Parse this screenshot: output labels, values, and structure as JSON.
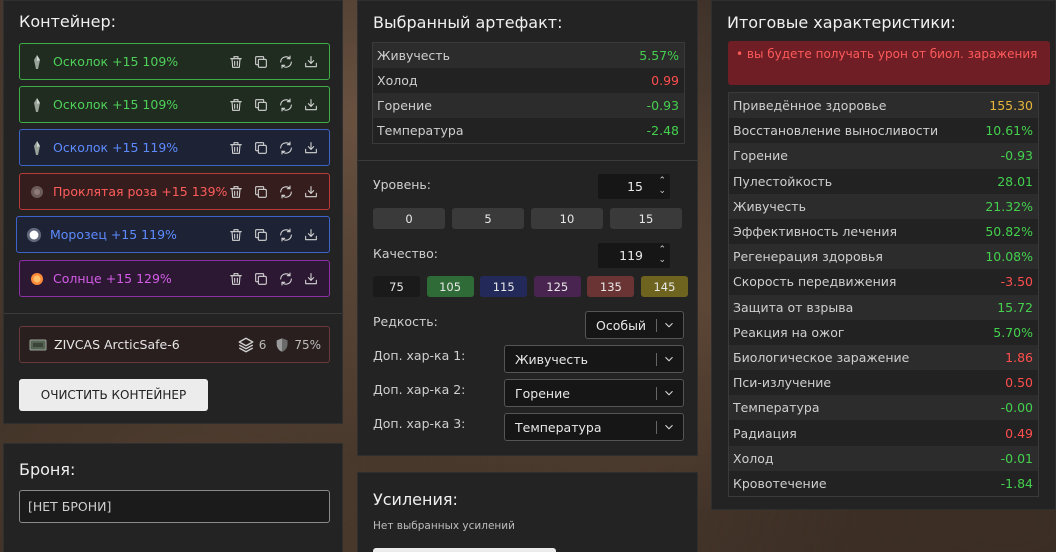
{
  "container": {
    "title": "Контейнер:",
    "artifacts": [
      {
        "name": "Осколок +15 109%",
        "color": "green",
        "icon": "shard-icon"
      },
      {
        "name": "Осколок +15 109%",
        "color": "green",
        "icon": "shard-icon"
      },
      {
        "name": "Осколок +15 119%",
        "color": "blue",
        "icon": "shard-icon"
      },
      {
        "name": "Проклятая роза +15 139%",
        "color": "red",
        "icon": "rose-icon"
      },
      {
        "name": "Морозец +15 119%",
        "color": "blue",
        "icon": "frost-icon"
      },
      {
        "name": "Солнце +15 129%",
        "color": "purple",
        "icon": "sun-icon"
      }
    ],
    "slot": {
      "name": "ZIVCAS ArcticSafe-6",
      "slots": "6",
      "protection": "75%"
    },
    "clear_button": "ОЧИСТИТЬ КОНТЕЙНЕР"
  },
  "armor": {
    "title": "Броня:",
    "value": "[НЕТ БРОНИ]"
  },
  "selected": {
    "title": "Выбранный артефакт:",
    "stats": [
      {
        "label": "Живучесть",
        "value": "5.57%",
        "tone": "pos"
      },
      {
        "label": "Холод",
        "value": "0.99",
        "tone": "neg"
      },
      {
        "label": "Горение",
        "value": "-0.93",
        "tone": "pos"
      },
      {
        "label": "Температура",
        "value": "-2.48",
        "tone": "pos"
      }
    ],
    "level_label": "Уровень:",
    "level_value": "15",
    "level_presets": [
      "0",
      "5",
      "10",
      "15"
    ],
    "quality_label": "Качество:",
    "quality_value": "119",
    "quality_presets": [
      {
        "label": "75",
        "color": "#1a1a1a"
      },
      {
        "label": "105",
        "color": "#2f6b36"
      },
      {
        "label": "115",
        "color": "#232a5a"
      },
      {
        "label": "125",
        "color": "#4a2450"
      },
      {
        "label": "135",
        "color": "#6b3434"
      },
      {
        "label": "145",
        "color": "#6e6420"
      }
    ],
    "rarity_label": "Редкость:",
    "rarity_value": "Особый",
    "extra1_label": "Доп. хар-ка 1:",
    "extra1_value": "Живучесть",
    "extra2_label": "Доп. хар-ка 2:",
    "extra2_value": "Горение",
    "extra3_label": "Доп. хар-ка 3:",
    "extra3_value": "Температура"
  },
  "boosts": {
    "title": "Усиления:",
    "empty_text": "Нет выбранных усилений"
  },
  "final": {
    "title": "Итоговые характеристики:",
    "warning": "•   вы будете получать урон от биол. заражения",
    "stats": [
      {
        "label": "Приведённое здоровье",
        "value": "155.30",
        "tone": "gold"
      },
      {
        "label": "Восстановление выносливости",
        "value": "10.61%",
        "tone": "pos"
      },
      {
        "label": "Горение",
        "value": "-0.93",
        "tone": "pos"
      },
      {
        "label": "Пулестойкость",
        "value": "28.01",
        "tone": "pos"
      },
      {
        "label": "Живучесть",
        "value": "21.32%",
        "tone": "pos"
      },
      {
        "label": "Эффективность лечения",
        "value": "50.82%",
        "tone": "pos"
      },
      {
        "label": "Регенерация здоровья",
        "value": "10.08%",
        "tone": "pos"
      },
      {
        "label": "Скорость передвижения",
        "value": "-3.50",
        "tone": "neg"
      },
      {
        "label": "Защита от взрыва",
        "value": "15.72",
        "tone": "pos"
      },
      {
        "label": "Реакция на ожог",
        "value": "5.70%",
        "tone": "pos"
      },
      {
        "label": "Биологическое заражение",
        "value": "1.86",
        "tone": "neg"
      },
      {
        "label": "Пси-излучение",
        "value": "0.50",
        "tone": "neg"
      },
      {
        "label": "Температура",
        "value": "-0.00",
        "tone": "pos"
      },
      {
        "label": "Радиация",
        "value": "0.49",
        "tone": "neg"
      },
      {
        "label": "Холод",
        "value": "-0.01",
        "tone": "pos"
      },
      {
        "label": "Кровотечение",
        "value": "-1.84",
        "tone": "pos"
      }
    ]
  }
}
